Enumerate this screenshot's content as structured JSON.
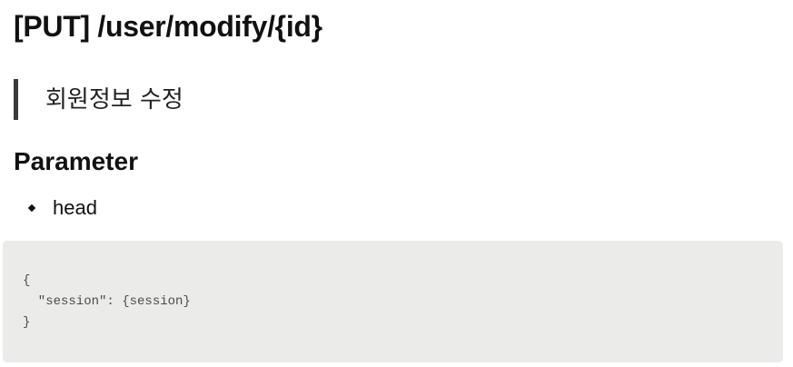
{
  "endpoint": {
    "title": "[PUT] /user/modify/{id}"
  },
  "description": {
    "text": "회원정보 수정"
  },
  "parameter": {
    "heading": "Parameter",
    "items": [
      {
        "label": "head"
      }
    ]
  },
  "code": {
    "lines": [
      "{",
      "  \"session\": {session}",
      "}"
    ]
  }
}
